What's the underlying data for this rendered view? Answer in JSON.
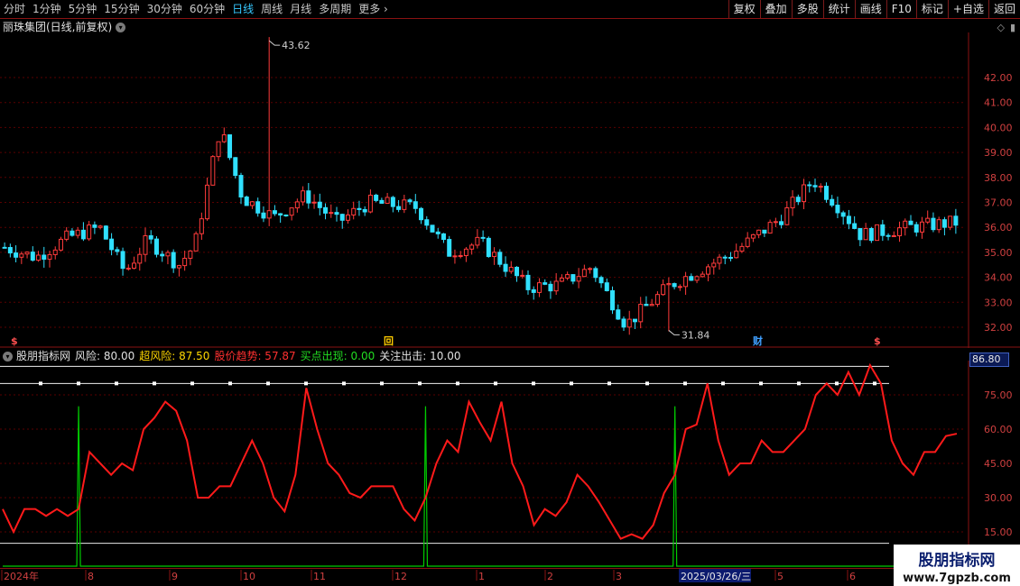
{
  "toolbar": {
    "periods": [
      "分时",
      "1分钟",
      "5分钟",
      "15分钟",
      "30分钟",
      "60分钟",
      "日线",
      "周线",
      "月线",
      "多周期"
    ],
    "active": "日线",
    "more": "更多",
    "buttons": [
      "复权",
      "叠加",
      "多股",
      "统计",
      "画线",
      "F10",
      "标记",
      "+自选",
      "返回"
    ]
  },
  "stock": {
    "title": "丽珠集团(日线,前复权)"
  },
  "colors": {
    "up": "#ff3b3b",
    "down": "#30e0ff",
    "risk": "#ff1a1a",
    "signal": "#00cc00",
    "grid": "#5a0000"
  },
  "main_chart": {
    "high_label": "43.62",
    "low_label": "31.84",
    "y_ticks": [
      "42.00",
      "41.00",
      "40.00",
      "39.00",
      "38.00",
      "37.00",
      "36.00",
      "35.00",
      "34.00",
      "33.00",
      "32.00"
    ],
    "markers": [
      "$",
      "回",
      "财",
      "$"
    ]
  },
  "indicator": {
    "name": "股朋指标网",
    "fengxian": "风险: 80.00",
    "chaofengxian": "超风险: 87.50",
    "gujiaqushi": "股价趋势: 57.87",
    "maidian": "买点出现: 0.00",
    "guanzhu": "关注出击: 10.00",
    "current_value": "86.80",
    "y_ticks": [
      "75.00",
      "60.00",
      "45.00",
      "30.00",
      "15.00"
    ]
  },
  "dates": {
    "labels": [
      "2024年",
      "8",
      "9",
      "10",
      "11",
      "12",
      "1",
      "2",
      "3",
      "5",
      "6"
    ],
    "cursor": "2025/03/26/三"
  },
  "watermark": {
    "line1": "股朋指标网",
    "line2": "www.7gpzb.com"
  },
  "chart_data": {
    "type": "line",
    "series": [
      {
        "name": "股价趋势",
        "values": [
          25,
          15,
          25,
          25,
          22,
          25,
          22,
          25,
          50,
          45,
          40,
          45,
          42,
          60,
          65,
          72,
          68,
          55,
          30,
          30,
          35,
          35,
          45,
          55,
          45,
          30,
          24,
          40,
          78,
          60,
          45,
          40,
          32,
          30,
          35,
          35,
          35,
          25,
          20,
          30,
          45,
          55,
          50,
          72,
          63,
          55,
          72,
          45,
          35,
          18,
          25,
          22,
          28,
          40,
          35,
          28,
          20,
          12,
          14,
          12,
          18,
          32,
          40,
          60,
          62,
          80,
          55,
          40,
          45,
          45,
          55,
          50,
          50,
          55,
          60,
          75,
          80,
          75,
          85,
          75,
          88,
          80,
          55,
          45,
          40,
          50,
          50,
          57,
          58
        ]
      },
      {
        "name": "买点出现",
        "values": [
          0,
          0,
          0,
          0,
          0,
          0,
          0,
          70,
          0,
          0,
          0,
          0,
          0,
          0,
          0,
          0,
          0,
          0,
          0,
          0,
          0,
          0,
          0,
          0,
          0,
          0,
          0,
          0,
          0,
          0,
          0,
          0,
          0,
          0,
          0,
          0,
          0,
          0,
          0,
          70,
          0,
          0,
          0,
          0,
          0,
          0,
          0,
          0,
          0,
          0,
          0,
          0,
          0,
          0,
          0,
          0,
          0,
          0,
          0,
          0,
          0,
          0,
          70,
          0,
          0,
          0,
          0,
          0,
          0,
          0,
          0,
          0,
          0,
          0,
          0,
          0,
          0,
          0,
          0,
          0,
          0,
          0,
          0,
          0,
          0,
          0,
          0,
          0,
          0
        ]
      }
    ],
    "reference_lines": [
      {
        "name": "风险",
        "value": 80
      },
      {
        "name": "超风险",
        "value": 87.5
      },
      {
        "name": "关注出击",
        "value": 10
      }
    ],
    "ylim": [
      0,
      90
    ]
  }
}
